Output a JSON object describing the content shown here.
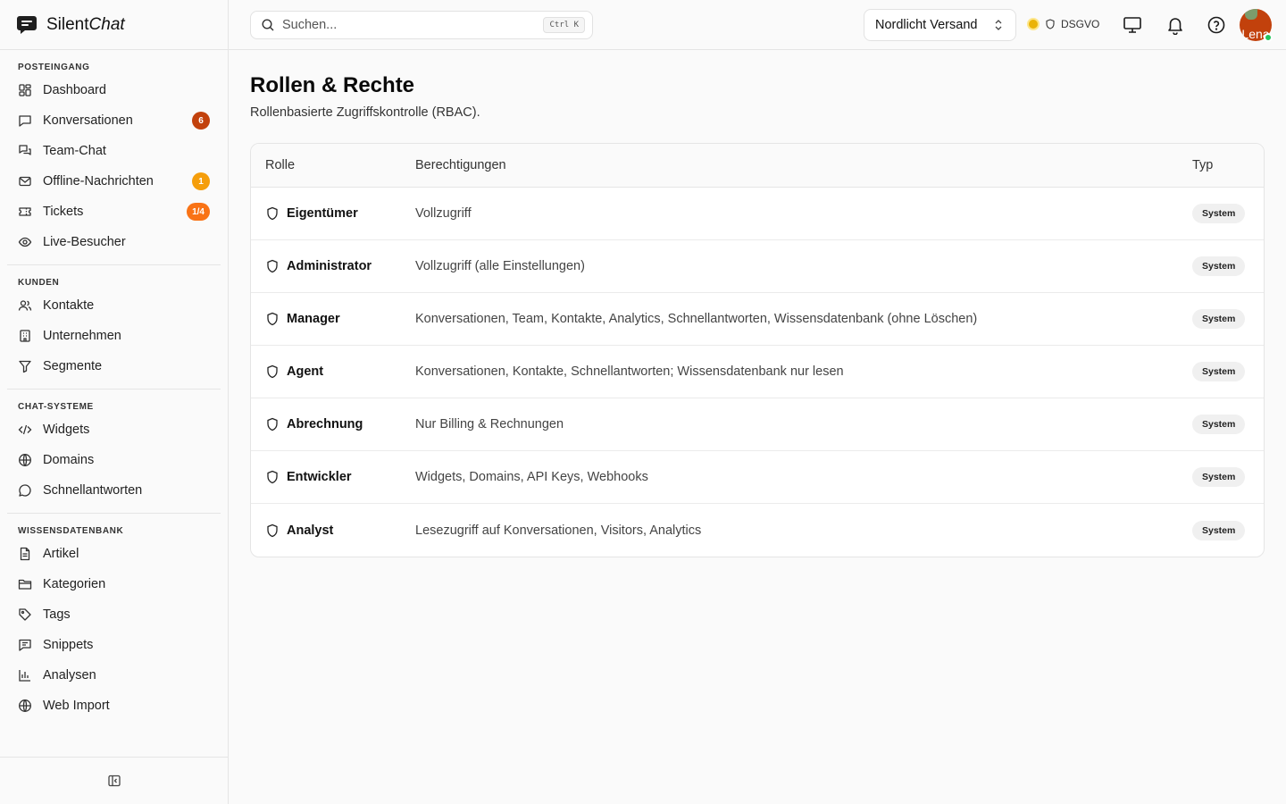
{
  "brand": {
    "name_part1": "Silent",
    "name_part2": "Chat"
  },
  "sidebar": {
    "sections": [
      {
        "title": "POSTEINGANG",
        "items": [
          {
            "label": "Dashboard",
            "icon": "dashboard-icon"
          },
          {
            "label": "Konversationen",
            "icon": "message-square-icon",
            "badge": "6"
          },
          {
            "label": "Team-Chat",
            "icon": "messages-icon"
          },
          {
            "label": "Offline-Nachrichten",
            "icon": "mail-icon",
            "badge": "1"
          },
          {
            "label": "Tickets",
            "icon": "ticket-icon",
            "badge": "1/4"
          },
          {
            "label": "Live-Besucher",
            "icon": "eye-icon"
          }
        ]
      },
      {
        "title": "KUNDEN",
        "items": [
          {
            "label": "Kontakte",
            "icon": "users-icon"
          },
          {
            "label": "Unternehmen",
            "icon": "building-icon"
          },
          {
            "label": "Segmente",
            "icon": "filter-icon"
          }
        ]
      },
      {
        "title": "CHAT-SYSTEME",
        "items": [
          {
            "label": "Widgets",
            "icon": "code-icon"
          },
          {
            "label": "Domains",
            "icon": "globe-icon"
          },
          {
            "label": "Schnellantworten",
            "icon": "chat-bubble-icon"
          }
        ]
      },
      {
        "title": "WISSENSDATENBANK",
        "items": [
          {
            "label": "Artikel",
            "icon": "file-text-icon"
          },
          {
            "label": "Kategorien",
            "icon": "folder-icon"
          },
          {
            "label": "Tags",
            "icon": "tag-icon"
          },
          {
            "label": "Snippets",
            "icon": "snippet-icon"
          },
          {
            "label": "Analysen",
            "icon": "bar-chart-icon"
          },
          {
            "label": "Web Import",
            "icon": "globe-icon"
          }
        ]
      }
    ]
  },
  "topbar": {
    "search_placeholder": "Suchen...",
    "search_shortcut": "Ctrl K",
    "workspace": "Nordlicht Versand",
    "compliance_label": "DSGVO",
    "avatar_text": "Lena"
  },
  "page": {
    "title": "Rollen & Rechte",
    "subtitle": "Rollenbasierte Zugriffskontrolle (RBAC)."
  },
  "table": {
    "columns": {
      "role": "Rolle",
      "permissions": "Berechtigungen",
      "type": "Typ"
    },
    "rows": [
      {
        "role": "Eigentümer",
        "permissions": "Vollzugriff",
        "type": "System"
      },
      {
        "role": "Administrator",
        "permissions": "Vollzugriff (alle Einstellungen)",
        "type": "System"
      },
      {
        "role": "Manager",
        "permissions": "Konversationen, Team, Kontakte, Analytics, Schnellantworten, Wissensdatenbank (ohne Löschen)",
        "type": "System"
      },
      {
        "role": "Agent",
        "permissions": "Konversationen, Kontakte, Schnellantworten; Wissensdatenbank nur lesen",
        "type": "System"
      },
      {
        "role": "Abrechnung",
        "permissions": "Nur Billing & Rechnungen",
        "type": "System"
      },
      {
        "role": "Entwickler",
        "permissions": "Widgets, Domains, API Keys, Webhooks",
        "type": "System"
      },
      {
        "role": "Analyst",
        "permissions": "Lesezugriff auf Konversationen, Visitors, Analytics",
        "type": "System"
      }
    ]
  },
  "colors": {
    "badge_red": "#c2410c",
    "badge_yellow": "#f59e0b",
    "badge_orange": "#f97316",
    "status_dot": "#eab308",
    "online": "#22c55e"
  }
}
